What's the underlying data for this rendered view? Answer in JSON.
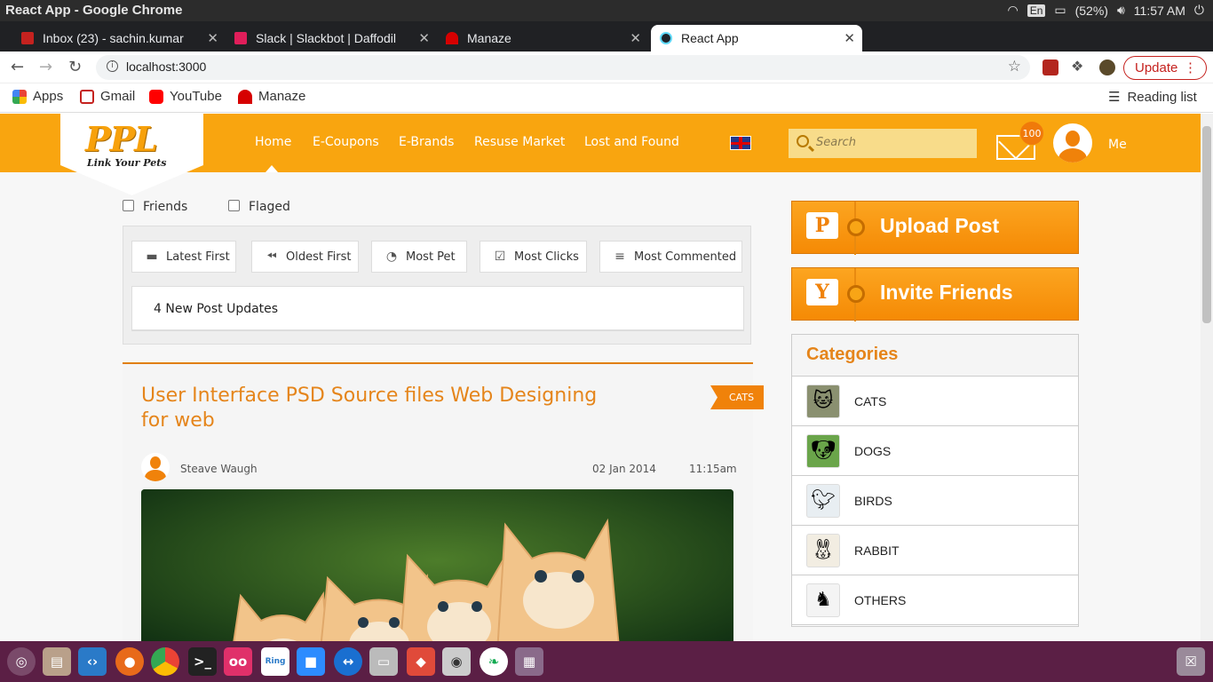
{
  "os": {
    "window_title": "React App - Google Chrome",
    "keyboard": "En",
    "battery": "(52%)",
    "clock": "11:57 AM"
  },
  "tabs": [
    {
      "title": "Inbox (23) - sachin.kumar",
      "favicon_color": "#c5221f"
    },
    {
      "title": "Slack | Slackbot | Daffodil",
      "favicon_color": "#e01e5a"
    },
    {
      "title": "Manaze",
      "favicon_color": "#d60000"
    },
    {
      "title": "React App",
      "favicon_color": "#61dafb"
    }
  ],
  "omnibox": {
    "url": "localhost:3000"
  },
  "update_label": "Update",
  "bookmarks": {
    "items": [
      {
        "label": "Apps"
      },
      {
        "label": "Gmail"
      },
      {
        "label": "YouTube"
      },
      {
        "label": "Manaze"
      }
    ],
    "reading_list": "Reading list"
  },
  "site": {
    "logo_title": "PPL",
    "logo_subtitle": "Link Your Pets",
    "menu": [
      "Home",
      "E-Coupons",
      "E-Brands",
      "Resuse Market",
      "Lost and Found"
    ],
    "search_placeholder": "Search",
    "mail_count": "100",
    "me_label": "Me",
    "accent": "#f9a50f"
  },
  "filters": {
    "checkboxes": [
      "Friends",
      "Flaged"
    ],
    "sort_buttons": [
      "Latest First",
      "Oldest First",
      "Most Pet",
      "Most Clicks",
      "Most Commented"
    ],
    "updates_text": "4 New Post Updates"
  },
  "post": {
    "title": "User Interface PSD Source files Web Designing for web",
    "tag": "CATS",
    "author": "Steave Waugh",
    "date": "02 Jan 2014",
    "time": "11:15am"
  },
  "sidebar": {
    "upload_label": "Upload Post",
    "upload_icon": "P",
    "invite_label": "Invite Friends",
    "categories_title": "Categories",
    "categories": [
      "CATS",
      "DOGS",
      "BIRDS",
      "RABBIT",
      "OTHERS"
    ]
  }
}
